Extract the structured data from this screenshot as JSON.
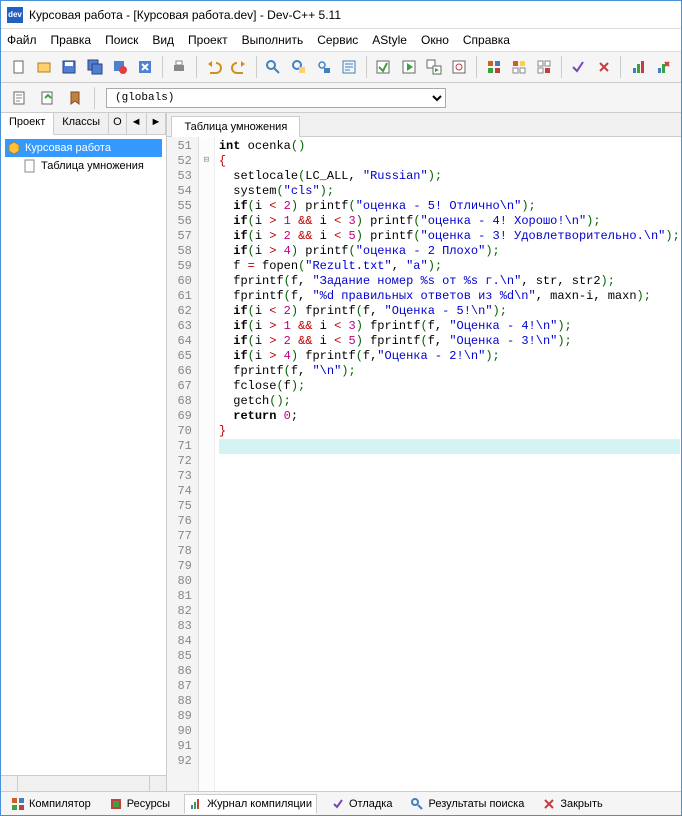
{
  "title": "Курсовая работа - [Курсовая работа.dev] - Dev-C++ 5.11",
  "menu": [
    "Файл",
    "Правка",
    "Поиск",
    "Вид",
    "Проект",
    "Выполнить",
    "Сервис",
    "AStyle",
    "Окно",
    "Справка"
  ],
  "globals": "(globals)",
  "left_tabs": {
    "t0": "Проект",
    "t1": "Классы",
    "t2": "О",
    "t3": "◄",
    "t4": "►"
  },
  "tree": {
    "root": "Курсовая работа",
    "child": "Таблица умножения"
  },
  "editor_tab": "Таблица умножения",
  "line_nums": [
    "51",
    "52",
    "53",
    "54",
    "55",
    "56",
    "57",
    "58",
    "59",
    "60",
    "61",
    "62",
    "63",
    "64",
    "65",
    "66",
    "67",
    "68",
    "69",
    "70",
    "71",
    "72",
    "73",
    "74",
    "75",
    "76",
    "77",
    "78",
    "79",
    "80",
    "81",
    "82",
    "83",
    "84",
    "85",
    "86",
    "87",
    "88",
    "89",
    "90",
    "91",
    "92"
  ],
  "code": {
    "l51": {
      "a": "int",
      "b": " ocenka",
      "c": "()"
    },
    "l52": {
      "a": "{"
    },
    "l53": {
      "a": "  setlocale",
      "b": "(",
      "c": "LC_ALL",
      "d": ", ",
      "e": "\"Russian\"",
      "f": ");"
    },
    "l54": {
      "a": "  system",
      "b": "(",
      "c": "\"cls\"",
      "d": ");"
    },
    "l55": {
      "a": "  ",
      "b": "if",
      "c": "(",
      "d": "i ",
      "e": "<",
      "f": " ",
      "g": "2",
      "h": ")",
      "i": " printf",
      "j": "(",
      "k": "\"оценка - 5! Отлично\\n\"",
      "l": ");"
    },
    "l56": {
      "a": "  ",
      "b": "if",
      "c": "(",
      "d": "i ",
      "e": ">",
      "f": " ",
      "g": "1",
      "h": " ",
      "i": "&&",
      "j": " i ",
      "k": "<",
      "l": " ",
      "m": "3",
      "n": ")",
      "o": " printf",
      "p": "(",
      "q": "\"оценка - 4! Хорошо!\\n\"",
      "r": ");"
    },
    "l57": {
      "a": "  ",
      "b": "if",
      "c": "(",
      "d": "i ",
      "e": ">",
      "f": " ",
      "g": "2",
      "h": " ",
      "i": "&&",
      "j": " i ",
      "k": "<",
      "l": " ",
      "m": "5",
      "n": ")",
      "o": " printf",
      "p": "(",
      "q": "\"оценка - 3! Удовлетворительно.\\n\"",
      "r": ");"
    },
    "l58": {
      "a": "  ",
      "b": "if",
      "c": "(",
      "d": "i ",
      "e": ">",
      "f": " ",
      "g": "4",
      "h": ")",
      "i": " printf",
      "j": "(",
      "k": "\"оценка - 2 Плохо\"",
      "l": ");"
    },
    "l59": {
      "a": "  f ",
      "b": "=",
      "c": " fopen",
      "d": "(",
      "e": "\"Rezult.txt\"",
      "f": ", ",
      "g": "\"a\"",
      "h": ");"
    },
    "l60": {
      "a": "  fprintf",
      "b": "(",
      "c": "f, ",
      "d": "\"Задание номер %s от %s г.\\n\"",
      "e": ", str, str2",
      "f": ");"
    },
    "l61": {
      "a": "  fprintf",
      "b": "(",
      "c": "f, ",
      "d": "\"%d правильных ответов из %d\\n\"",
      "e": ", maxn-i, maxn",
      "f": ");"
    },
    "l62": {
      "a": "  ",
      "b": "if",
      "c": "(",
      "d": "i ",
      "e": "<",
      "f": " ",
      "g": "2",
      "h": ")",
      "i": " fprintf",
      "j": "(",
      "k": "f, ",
      "l": "\"Оценка - 5!\\n\"",
      "m": ");"
    },
    "l63": {
      "a": "  ",
      "b": "if",
      "c": "(",
      "d": "i ",
      "e": ">",
      "f": " ",
      "g": "1",
      "h": " ",
      "i": "&&",
      "j": " i ",
      "k": "<",
      "l": " ",
      "m": "3",
      "n": ")",
      "o": " fprintf",
      "p": "(",
      "q": "f, ",
      "r": "\"Оценка - 4!\\n\"",
      "s": ");"
    },
    "l64": {
      "a": "  ",
      "b": "if",
      "c": "(",
      "d": "i ",
      "e": ">",
      "f": " ",
      "g": "2",
      "h": " ",
      "i": "&&",
      "j": " i ",
      "k": "<",
      "l": " ",
      "m": "5",
      "n": ")",
      "o": " fprintf",
      "p": "(",
      "q": "f, ",
      "r": "\"Оценка - 3!\\n\"",
      "s": ");"
    },
    "l65": {
      "a": "  ",
      "b": "if",
      "c": "(",
      "d": "i ",
      "e": ">",
      "f": " ",
      "g": "4",
      "h": ")",
      "i": " fprintf",
      "j": "(",
      "k": "f,",
      "l": "\"Оценка - 2!\\n\"",
      "m": ");"
    },
    "l66": {
      "a": "  fprintf",
      "b": "(",
      "c": "f, ",
      "d": "\"\\n\"",
      "e": ");"
    },
    "l67": {
      "a": "  fclose",
      "b": "(",
      "c": "f",
      "d": ");"
    },
    "l68": {
      "a": "  getch",
      "b": "();"
    },
    "l69": {
      "a": "  ",
      "b": "return",
      "c": " ",
      "d": "0",
      "e": ";"
    },
    "l70": {
      "a": "}"
    }
  },
  "bottom": {
    "t0": "Компилятор",
    "t1": "Ресурсы",
    "t2": "Журнал компиляции",
    "t3": "Отладка",
    "t4": "Результаты поиска",
    "t5": "Закрыть"
  }
}
